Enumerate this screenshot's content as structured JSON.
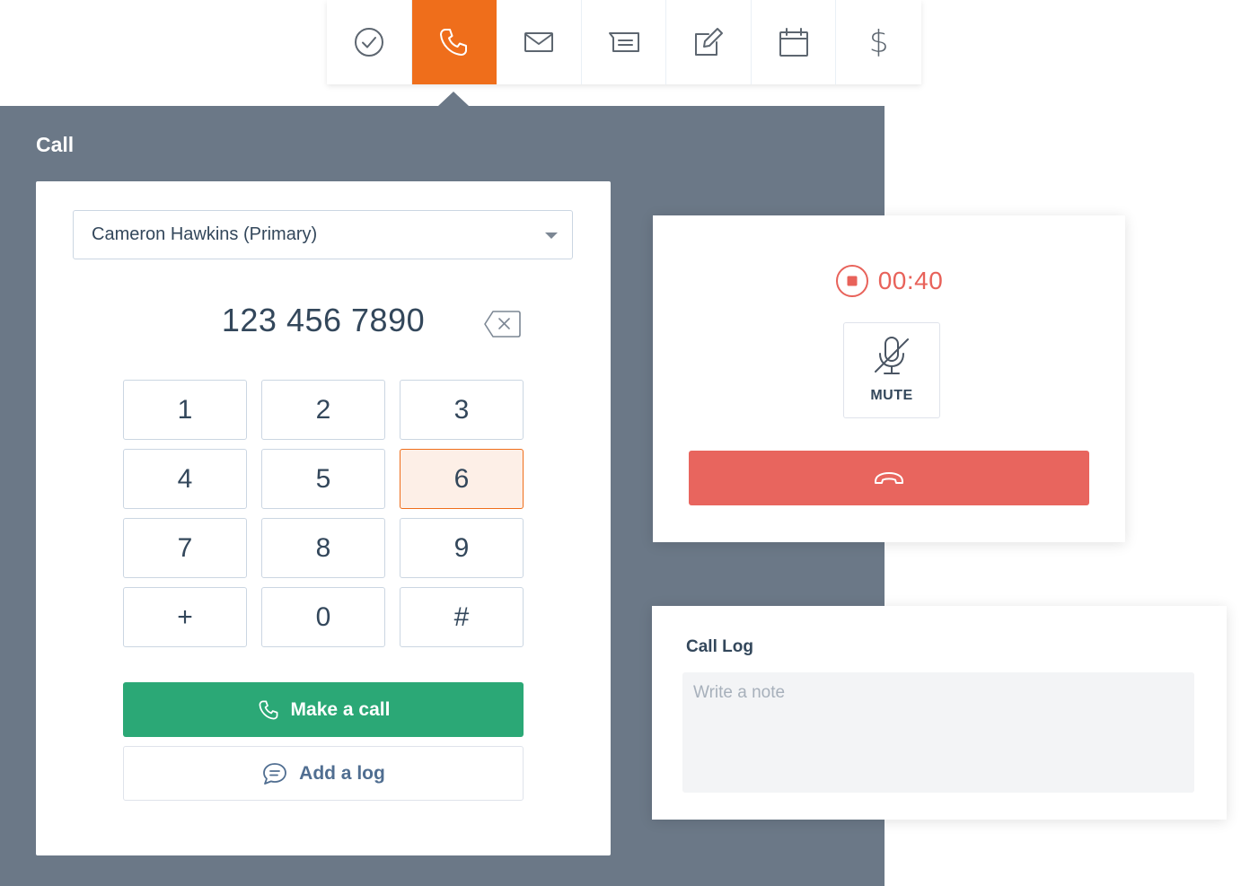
{
  "toolbar": {
    "active_index": 1,
    "tools": [
      {
        "icon": "check-circle-icon"
      },
      {
        "icon": "phone-icon"
      },
      {
        "icon": "envelope-icon"
      },
      {
        "icon": "ticket-icon"
      },
      {
        "icon": "edit-icon"
      },
      {
        "icon": "calendar-icon"
      },
      {
        "icon": "dollar-icon",
        "glyph": "$"
      }
    ]
  },
  "call_panel": {
    "title": "Call"
  },
  "dialer": {
    "contact": "Cameron Hawkins (Primary)",
    "number": "123 456 7890",
    "keys": [
      "1",
      "2",
      "3",
      "4",
      "5",
      "6",
      "7",
      "8",
      "9",
      "+",
      "0",
      "#"
    ],
    "highlighted_key": "6",
    "make_call_label": "Make a call",
    "add_log_label": "Add a log"
  },
  "active_call": {
    "timer": "00:40",
    "mute_label": "MUTE"
  },
  "call_log": {
    "title": "Call Log",
    "placeholder": "Write a note"
  },
  "colors": {
    "accent_orange": "#ef6e1b",
    "panel_gray": "#6b7887",
    "call_green": "#2ba876",
    "hangup_red": "#e8655e",
    "timer_red": "#e8625a"
  }
}
